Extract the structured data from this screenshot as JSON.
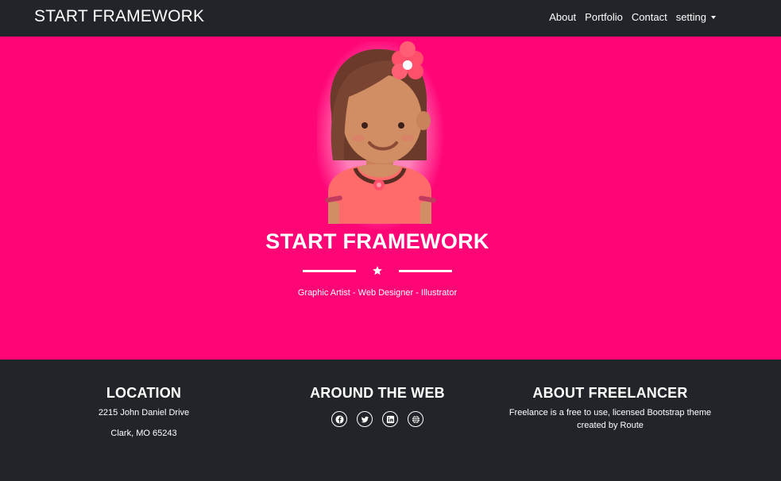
{
  "navbar": {
    "brand": "START FRAMEWORK",
    "links": [
      {
        "label": "About"
      },
      {
        "label": "Portfolio"
      },
      {
        "label": "Contact"
      },
      {
        "label": "setting"
      }
    ]
  },
  "hero": {
    "title": "START FRAMEWORK",
    "subtitle": "Graphic Artist - Web Designer - Illustrator",
    "divider_icon": "star-icon",
    "avatar_icon": "girl-avatar-icon"
  },
  "footer": {
    "location": {
      "heading": "LOCATION",
      "line1": "2215 John Daniel Drive",
      "line2": "Clark, MO 65243"
    },
    "web": {
      "heading": "AROUND THE WEB",
      "icons": [
        "facebook-icon",
        "twitter-icon",
        "linkedin-icon",
        "globe-icon"
      ]
    },
    "about": {
      "heading": "ABOUT FREELANCER",
      "text": "Freelance is a free to use, licensed Bootstrap theme created by Route"
    }
  },
  "colors": {
    "hero_bg": "#ff0677",
    "dark_bg": "#212529",
    "text": "#ffffff"
  }
}
